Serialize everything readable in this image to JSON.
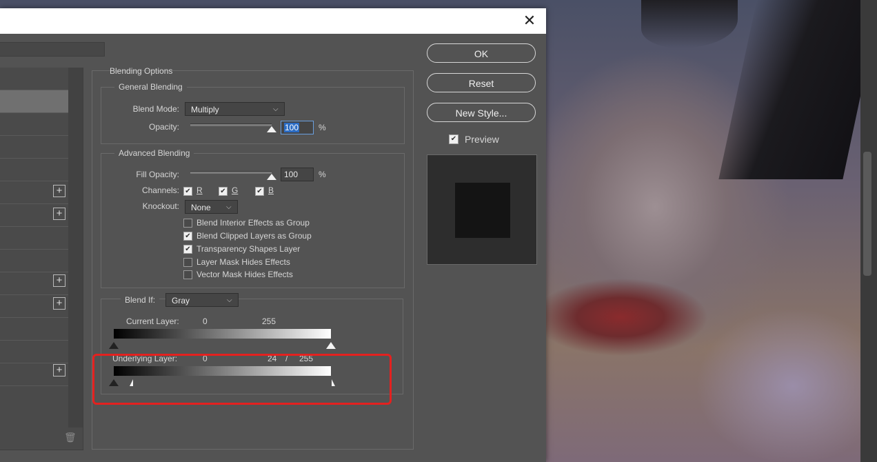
{
  "dialog": {
    "close_glyph": "✕"
  },
  "buttons": {
    "ok": "OK",
    "reset": "Reset",
    "new_style": "New Style...",
    "preview": "Preview"
  },
  "blending_options": {
    "title": "Blending Options",
    "general": {
      "title": "General Blending",
      "blend_mode_label": "Blend Mode:",
      "blend_mode_value": "Multiply",
      "opacity_label": "Opacity:",
      "opacity_value": "100",
      "opacity_unit": "%",
      "opacity_fraction": 1.0
    },
    "advanced": {
      "title": "Advanced Blending",
      "fill_opacity_label": "Fill Opacity:",
      "fill_opacity_value": "100",
      "fill_opacity_unit": "%",
      "fill_opacity_fraction": 1.0,
      "channels_label": "Channels:",
      "channels": [
        {
          "label": "R",
          "checked": true
        },
        {
          "label": "G",
          "checked": true
        },
        {
          "label": "B",
          "checked": true
        }
      ],
      "knockout_label": "Knockout:",
      "knockout_value": "None",
      "options": [
        {
          "label": "Blend Interior Effects as Group",
          "checked": false
        },
        {
          "label": "Blend Clipped Layers as Group",
          "checked": true
        },
        {
          "label": "Transparency Shapes Layer",
          "checked": true
        },
        {
          "label": "Layer Mask Hides Effects",
          "checked": false
        },
        {
          "label": "Vector Mask Hides Effects",
          "checked": false
        }
      ]
    },
    "blend_if": {
      "label": "Blend If:",
      "value": "Gray",
      "current_layer": {
        "label": "Current Layer:",
        "low": "0",
        "high": "255"
      },
      "underlying_layer": {
        "label": "Underlying Layer:",
        "low": "0",
        "split_value": "24",
        "separator": "/",
        "high": "255"
      }
    }
  },
  "styles_list": {
    "plus_glyph": "+",
    "trash_glyph": "🗑"
  },
  "colors": {
    "dialog_bg": "#535353",
    "highlight": "#e4211f",
    "input_selection": "#2b6cc4"
  }
}
